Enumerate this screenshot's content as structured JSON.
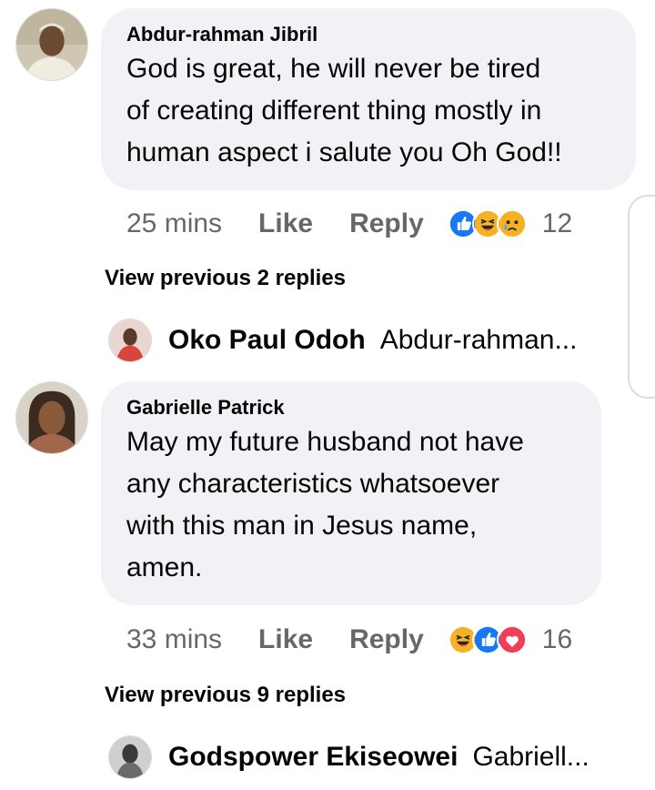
{
  "comments": [
    {
      "author": "Abdur-rahman Jibril",
      "text_lines": [
        "God is great, he will never be tired",
        "of creating different thing mostly in",
        "human aspect i salute you Oh God!!"
      ],
      "time": "25 mins",
      "like_label": "Like",
      "reply_label": "Reply",
      "reactions": [
        "like",
        "haha",
        "sad"
      ],
      "reaction_count": "12",
      "view_previous": "View previous 2 replies",
      "latest_reply": {
        "author": "Oko Paul Odoh",
        "preview": "Abdur-rahman..."
      }
    },
    {
      "author": "Gabrielle Patrick",
      "text_lines": [
        "May my future husband not have",
        "any characteristics whatsoever",
        "with this man in Jesus name,",
        "amen."
      ],
      "time": "33 mins",
      "like_label": "Like",
      "reply_label": "Reply",
      "reactions": [
        "haha",
        "like",
        "love"
      ],
      "reaction_count": "16",
      "view_previous": "View previous 9 replies",
      "latest_reply": {
        "author": "Godspower Ekiseowei",
        "preview": "Gabriell..."
      }
    }
  ],
  "colors": {
    "bubble": "#f0f2f5",
    "muted_text": "#65676b",
    "like_blue": "#1877f2",
    "haha_yellow": "#f7b125",
    "love_red": "#f33e58"
  }
}
